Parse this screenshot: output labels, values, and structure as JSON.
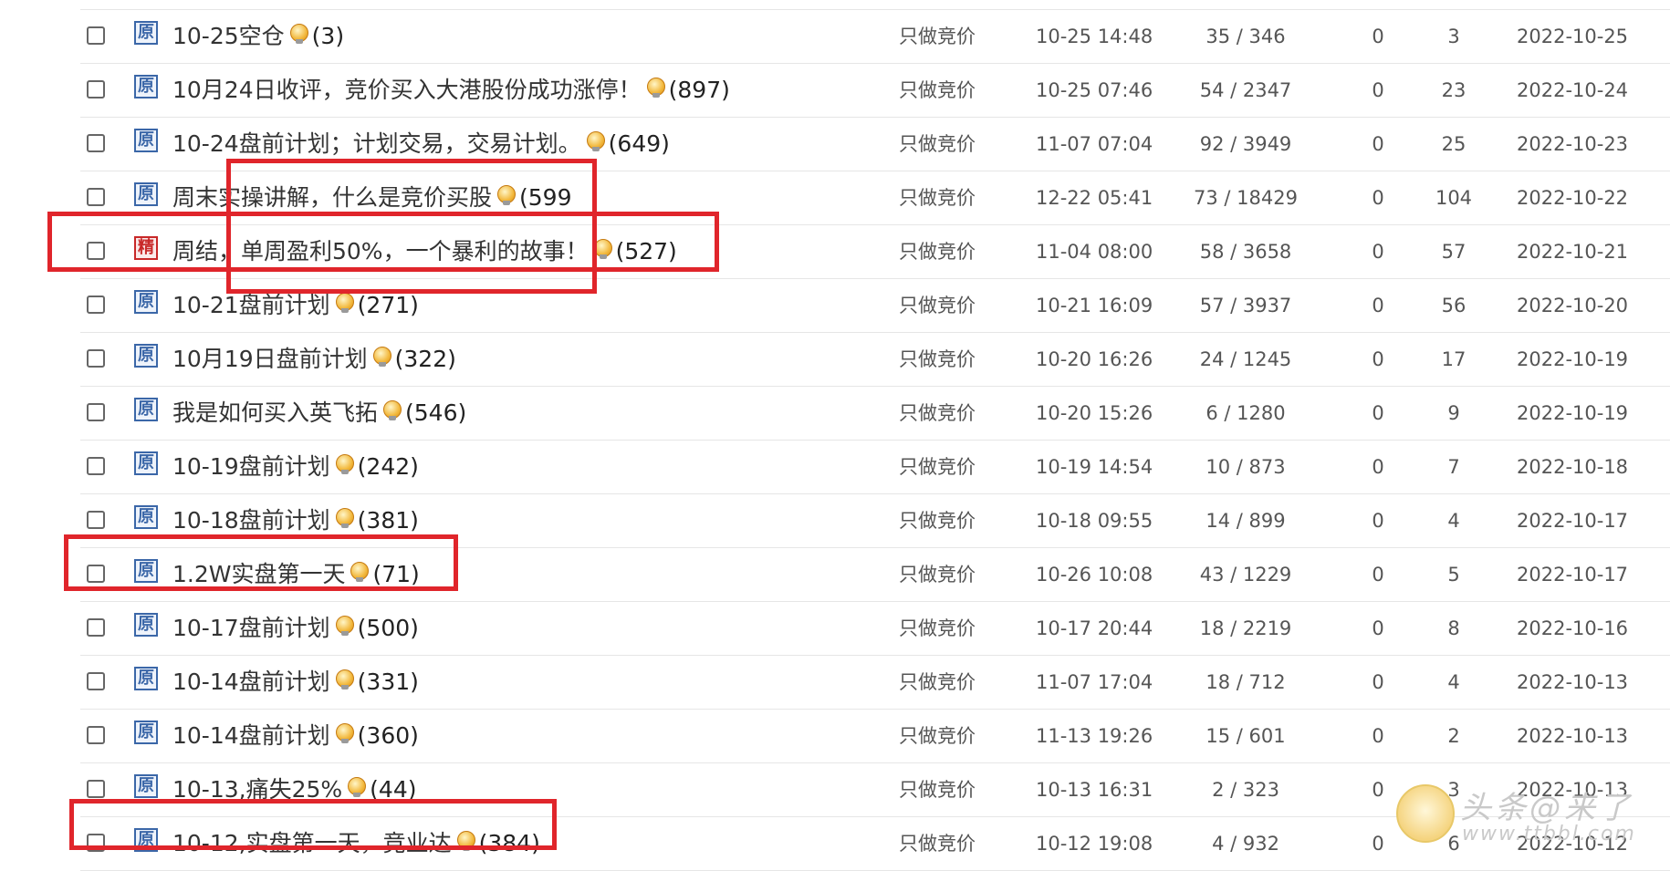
{
  "rows": [
    {
      "tag": "原",
      "tag_type": "yuan",
      "title": "10-25空仓",
      "count": "(3)",
      "category": "只做竞价",
      "last": "10-25 14:48",
      "rv": "35 / 346",
      "zero": "0",
      "num": "3",
      "date": "2022-10-25"
    },
    {
      "tag": "原",
      "tag_type": "yuan",
      "title": "10月24日收评，竞价买入大港股份成功涨停！",
      "count": "(897)",
      "category": "只做竞价",
      "last": "10-25 07:46",
      "rv": "54 / 2347",
      "zero": "0",
      "num": "23",
      "date": "2022-10-24"
    },
    {
      "tag": "原",
      "tag_type": "yuan",
      "title": "10-24盘前计划；计划交易，交易计划。",
      "count": "(649)",
      "category": "只做竞价",
      "last": "11-07 07:04",
      "rv": "92 / 3949",
      "zero": "0",
      "num": "25",
      "date": "2022-10-23"
    },
    {
      "tag": "原",
      "tag_type": "yuan",
      "title": "周末实操讲解，什么是竞价买股",
      "count": "(599",
      "category": "只做竞价",
      "last": "12-22 05:41",
      "rv": "73 / 18429",
      "zero": "0",
      "num": "104",
      "date": "2022-10-22"
    },
    {
      "tag": "精",
      "tag_type": "jing",
      "title": "周结，单周盈利50%，一个暴利的故事！",
      "count": "(527)",
      "category": "只做竞价",
      "last": "11-04 08:00",
      "rv": "58 / 3658",
      "zero": "0",
      "num": "57",
      "date": "2022-10-21"
    },
    {
      "tag": "原",
      "tag_type": "yuan",
      "title": "10-21盘前计划",
      "count": "(271)",
      "category": "只做竞价",
      "last": "10-21 16:09",
      "rv": "57 / 3937",
      "zero": "0",
      "num": "56",
      "date": "2022-10-20"
    },
    {
      "tag": "原",
      "tag_type": "yuan",
      "title": "10月19日盘前计划",
      "count": "(322)",
      "category": "只做竞价",
      "last": "10-20 16:26",
      "rv": "24 / 1245",
      "zero": "0",
      "num": "17",
      "date": "2022-10-19"
    },
    {
      "tag": "原",
      "tag_type": "yuan",
      "title": "我是如何买入英飞拓",
      "count": "(546)",
      "category": "只做竞价",
      "last": "10-20 15:26",
      "rv": "6 / 1280",
      "zero": "0",
      "num": "9",
      "date": "2022-10-19"
    },
    {
      "tag": "原",
      "tag_type": "yuan",
      "title": "10-19盘前计划",
      "count": "(242)",
      "category": "只做竞价",
      "last": "10-19 14:54",
      "rv": "10 / 873",
      "zero": "0",
      "num": "7",
      "date": "2022-10-18"
    },
    {
      "tag": "原",
      "tag_type": "yuan",
      "title": "10-18盘前计划",
      "count": "(381)",
      "category": "只做竞价",
      "last": "10-18 09:55",
      "rv": "14 / 899",
      "zero": "0",
      "num": "4",
      "date": "2022-10-17"
    },
    {
      "tag": "原",
      "tag_type": "yuan",
      "title": "1.2W实盘第一天",
      "count": "(71)",
      "category": "只做竞价",
      "last": "10-26 10:08",
      "rv": "43 / 1229",
      "zero": "0",
      "num": "5",
      "date": "2022-10-17"
    },
    {
      "tag": "原",
      "tag_type": "yuan",
      "title": "10-17盘前计划",
      "count": "(500)",
      "category": "只做竞价",
      "last": "10-17 20:44",
      "rv": "18 / 2219",
      "zero": "0",
      "num": "8",
      "date": "2022-10-16"
    },
    {
      "tag": "原",
      "tag_type": "yuan",
      "title": "10-14盘前计划",
      "count": "(331)",
      "category": "只做竞价",
      "last": "11-07 17:04",
      "rv": "18 / 712",
      "zero": "0",
      "num": "4",
      "date": "2022-10-13"
    },
    {
      "tag": "原",
      "tag_type": "yuan",
      "title": "10-14盘前计划",
      "count": "(360)",
      "category": "只做竞价",
      "last": "11-13 19:26",
      "rv": "15 / 601",
      "zero": "0",
      "num": "2",
      "date": "2022-10-13"
    },
    {
      "tag": "原",
      "tag_type": "yuan",
      "title": "10-13,痛失25%",
      "count": "(44)",
      "category": "只做竞价",
      "last": "10-13 16:31",
      "rv": "2 / 323",
      "zero": "0",
      "num": "3",
      "date": "2022-10-13"
    },
    {
      "tag": "原",
      "tag_type": "yuan",
      "title": "10-12,实盘第一天，竞业达",
      "count": "(384)",
      "category": "只做竞价",
      "last": "10-12 19:08",
      "rv": "4 / 932",
      "zero": "0",
      "num": "6",
      "date": "2022-10-12"
    }
  ],
  "watermark": {
    "line1": "头条@来了",
    "line2": "www.ttbbl.com"
  },
  "colors": {
    "highlight": "#e0252b",
    "tag_yuan": "#3b67a8",
    "tag_jing": "#c82828"
  }
}
